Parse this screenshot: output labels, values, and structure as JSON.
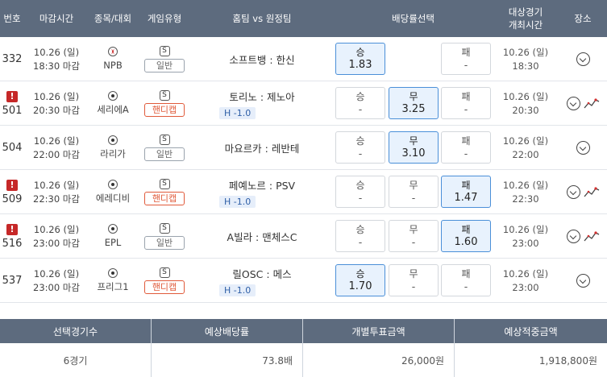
{
  "header": {
    "no": "번호",
    "deadline": "마감시간",
    "league": "종목/대회",
    "game_type": "게임유형",
    "teams": "홈팀 vs 원정팀",
    "odds": "배당률선택",
    "game_time_line1": "대상경기",
    "game_time_line2": "개최시간",
    "place": "장소"
  },
  "s_icon": "S",
  "rows": [
    {
      "no": "332",
      "warn": "",
      "deadline_date": "10.26 (일)",
      "deadline_time": "18:30 마감",
      "sport_icon": "baseball-icon",
      "league": "NPB",
      "type": "일반",
      "type_kind": "normal",
      "teams": "소프트뱅 : 한신",
      "handicap": "",
      "win_label": "승",
      "win_odds": "1.83",
      "draw_label": "",
      "draw_odds": "",
      "loss_label": "패",
      "loss_odds": "-",
      "selected": "win",
      "game_date": "10.26 (일)",
      "game_time": "18:30",
      "trend": false
    },
    {
      "no": "501",
      "warn": "!",
      "deadline_date": "10.26 (일)",
      "deadline_time": "20:30 마감",
      "sport_icon": "soccer-icon",
      "league": "세리에A",
      "type": "핸디캡",
      "type_kind": "handicap",
      "teams": "토리노 : 제노아",
      "handicap": "H -1.0",
      "win_label": "승",
      "win_odds": "-",
      "draw_label": "무",
      "draw_odds": "3.25",
      "loss_label": "패",
      "loss_odds": "-",
      "selected": "draw",
      "game_date": "10.26 (일)",
      "game_time": "20:30",
      "trend": true
    },
    {
      "no": "504",
      "warn": "",
      "deadline_date": "10.26 (일)",
      "deadline_time": "22:00 마감",
      "sport_icon": "soccer-icon",
      "league": "라리가",
      "type": "일반",
      "type_kind": "normal",
      "teams": "마요르카 : 레반테",
      "handicap": "",
      "win_label": "승",
      "win_odds": "-",
      "draw_label": "무",
      "draw_odds": "3.10",
      "loss_label": "패",
      "loss_odds": "-",
      "selected": "draw",
      "game_date": "10.26 (일)",
      "game_time": "22:00",
      "trend": false
    },
    {
      "no": "509",
      "warn": "!",
      "deadline_date": "10.26 (일)",
      "deadline_time": "22:30 마감",
      "sport_icon": "soccer-icon",
      "league": "에레디비",
      "type": "핸디캡",
      "type_kind": "handicap",
      "teams": "페예노르 : PSV",
      "handicap": "H -1.0",
      "win_label": "승",
      "win_odds": "-",
      "draw_label": "무",
      "draw_odds": "-",
      "loss_label": "패",
      "loss_odds": "1.47",
      "selected": "loss",
      "game_date": "10.26 (일)",
      "game_time": "22:30",
      "trend": true
    },
    {
      "no": "516",
      "warn": "!",
      "deadline_date": "10.26 (일)",
      "deadline_time": "23:00 마감",
      "sport_icon": "soccer-icon",
      "league": "EPL",
      "type": "일반",
      "type_kind": "normal",
      "teams": "A빌라 : 맨체스C",
      "handicap": "",
      "win_label": "승",
      "win_odds": "-",
      "draw_label": "무",
      "draw_odds": "-",
      "loss_label": "패",
      "loss_odds": "1.60",
      "selected": "loss",
      "game_date": "10.26 (일)",
      "game_time": "23:00",
      "trend": true
    },
    {
      "no": "537",
      "warn": "",
      "deadline_date": "10.26 (일)",
      "deadline_time": "23:00 마감",
      "sport_icon": "soccer-icon",
      "league": "프리그1",
      "type": "핸디캡",
      "type_kind": "handicap",
      "teams": "릴OSC : 메스",
      "handicap": "H -1.0",
      "win_label": "승",
      "win_odds": "1.70",
      "draw_label": "무",
      "draw_odds": "-",
      "loss_label": "패",
      "loss_odds": "-",
      "selected": "win",
      "game_date": "10.26 (일)",
      "game_time": "23:00",
      "trend": false
    }
  ],
  "summary": {
    "headers": [
      "선택경기수",
      "예상배당률",
      "개별투표금액",
      "예상적중금액"
    ],
    "values": [
      "6경기",
      "73.8배",
      "26,000원",
      "1,918,800원"
    ]
  },
  "colors": {
    "header_bg": "#5d6b7e",
    "selected_bg": "#e8f2fd",
    "selected_border": "#4a8fd8",
    "handicap_badge": "#e05a3a",
    "warn": "#c62828"
  }
}
